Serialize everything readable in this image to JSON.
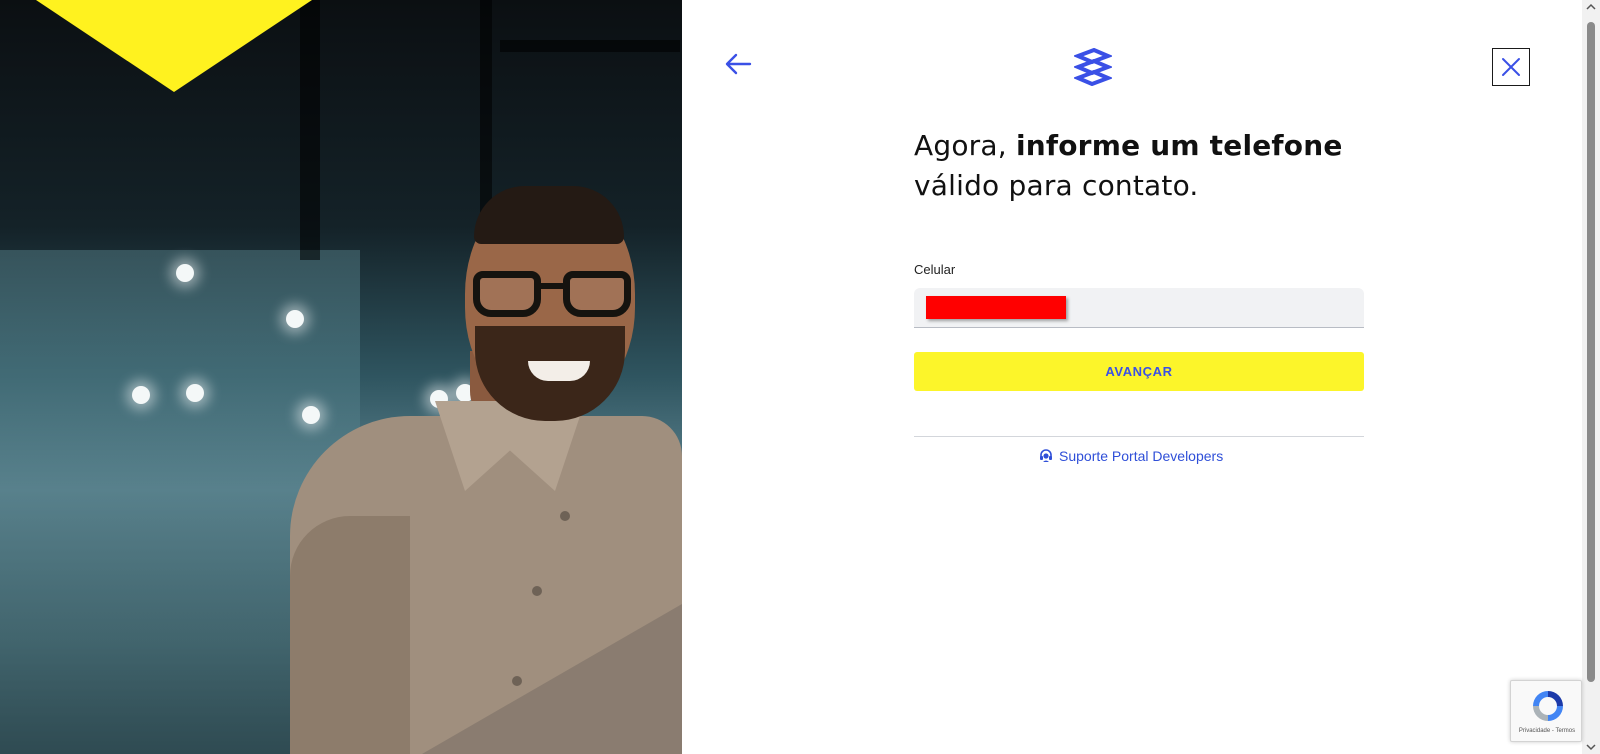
{
  "hero": {
    "image_description_icon": "photo-smiling-man-glasses"
  },
  "header": {
    "back_icon": "arrow-left-icon",
    "logo_icon": "bank-logo-icon",
    "close_icon": "close-icon"
  },
  "headline": {
    "prefix": "Agora, ",
    "bold": "informe um telefone",
    "suffix": "válido para contato."
  },
  "form": {
    "phone_label": "Celular",
    "phone_value": "",
    "submit_label": "AVANÇAR"
  },
  "support": {
    "icon": "headset-icon",
    "label": "Suporte Portal Developers"
  },
  "recaptcha": {
    "text": "Privacidade - Termos"
  },
  "colors": {
    "accent_yellow": "#fcf52a",
    "accent_blue": "#3a50e6",
    "redaction": "#ff0000"
  }
}
